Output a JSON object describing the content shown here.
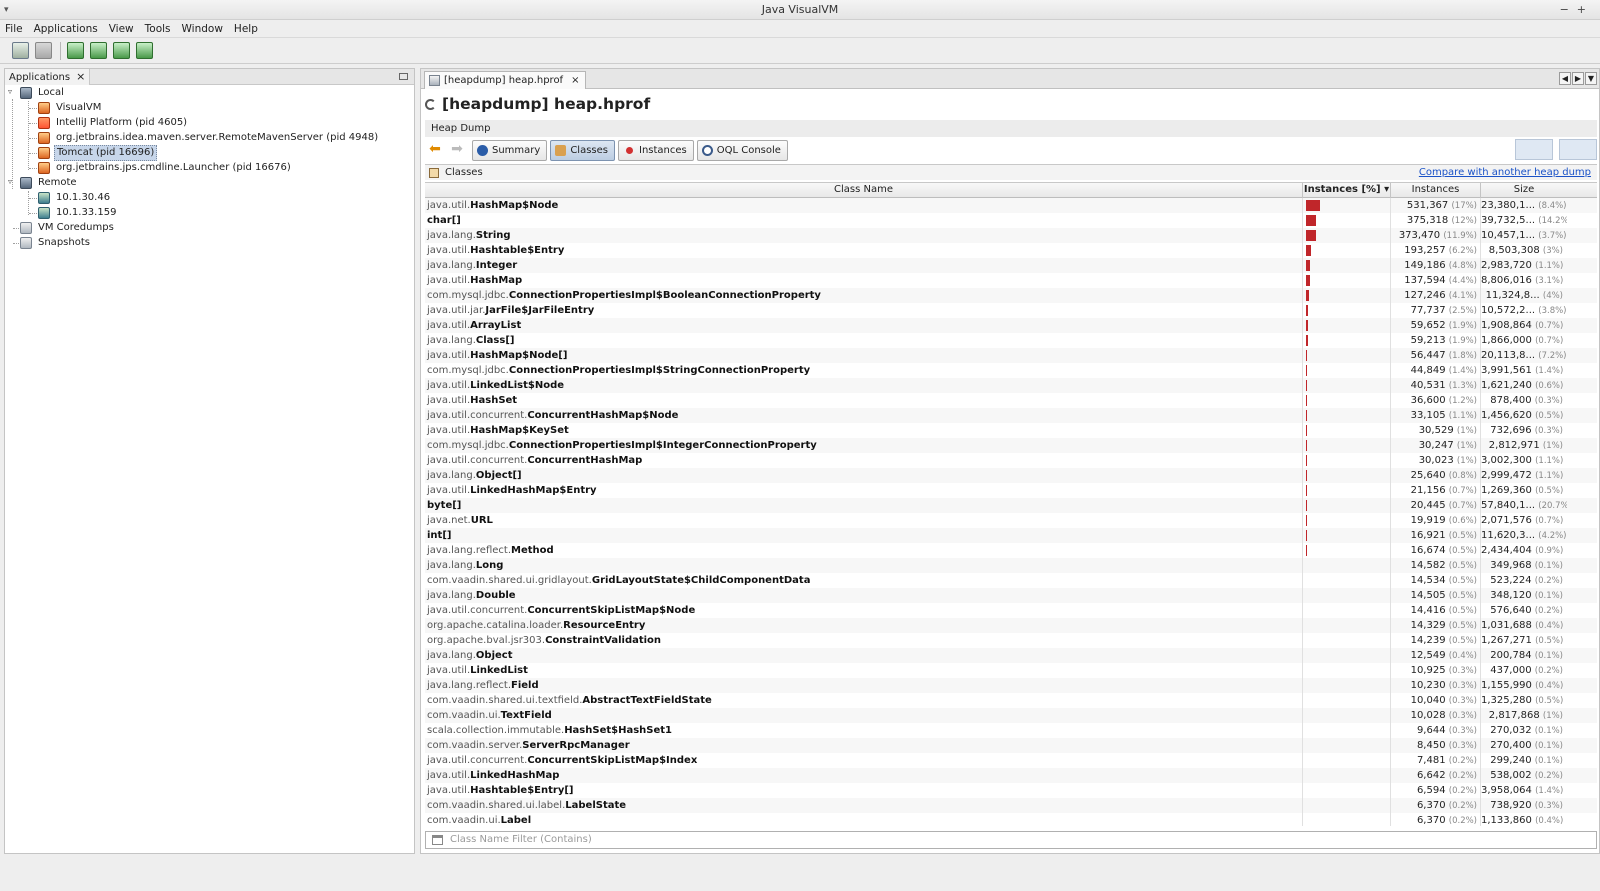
{
  "window": {
    "title": "Java VisualVM"
  },
  "menu": [
    "File",
    "Applications",
    "View",
    "Tools",
    "Window",
    "Help"
  ],
  "toolbar": {
    "icons": [
      "save-icon",
      "save-all-icon",
      "add-host-icon",
      "add-jmx-icon",
      "add-coredump-icon",
      "add-snapshot-icon"
    ]
  },
  "left_panel": {
    "tab_label": "Applications",
    "tree": {
      "local": "Local",
      "local_items": [
        "VisualVM",
        "IntelliJ Platform (pid 4605)",
        "org.jetbrains.idea.maven.server.RemoteMavenServer (pid 4948)",
        "Tomcat (pid 16696)",
        "org.jetbrains.jps.cmdline.Launcher (pid 16676)"
      ],
      "remote": "Remote",
      "remote_items": [
        "10.1.30.46",
        "10.1.33.159"
      ],
      "coredumps": "VM Coredumps",
      "snapshots": "Snapshots"
    }
  },
  "document": {
    "tab_label": "[heapdump] heap.hprof",
    "heading": "[heapdump] heap.hprof",
    "section_label": "Heap Dump",
    "views": [
      "Summary",
      "Classes",
      "Instances",
      "OQL Console"
    ],
    "active_view": "Classes",
    "classes_label": "Classes",
    "compare_link": "Compare with another heap dump",
    "columns": {
      "name": "Class Name",
      "pct": "Instances [%]",
      "instances": "Instances",
      "size": "Size"
    },
    "filter_placeholder": "Class Name Filter (Contains)"
  },
  "rows": [
    {
      "pkg": "java.util.",
      "cls": "HashMap$Node",
      "pct": 17,
      "inst": "531,367",
      "ip": "(17%)",
      "size": "23,380,1...",
      "sp": "(8.4%)"
    },
    {
      "pkg": "",
      "cls": "char[]",
      "pct": 12,
      "inst": "375,318",
      "ip": "(12%)",
      "size": "39,732,5...",
      "sp": "(14.2%)"
    },
    {
      "pkg": "java.lang.",
      "cls": "String",
      "pct": 11.9,
      "inst": "373,470",
      "ip": "(11.9%)",
      "size": "10,457,1...",
      "sp": "(3.7%)"
    },
    {
      "pkg": "java.util.",
      "cls": "Hashtable$Entry",
      "pct": 6.2,
      "inst": "193,257",
      "ip": "(6.2%)",
      "size": "8,503,308",
      "sp": "(3%)"
    },
    {
      "pkg": "java.lang.",
      "cls": "Integer",
      "pct": 4.8,
      "inst": "149,186",
      "ip": "(4.8%)",
      "size": "2,983,720",
      "sp": "(1.1%)"
    },
    {
      "pkg": "java.util.",
      "cls": "HashMap",
      "pct": 4.4,
      "inst": "137,594",
      "ip": "(4.4%)",
      "size": "8,806,016",
      "sp": "(3.1%)"
    },
    {
      "pkg": "com.mysql.jdbc.",
      "cls": "ConnectionPropertiesImpl$BooleanConnectionProperty",
      "pct": 4.1,
      "inst": "127,246",
      "ip": "(4.1%)",
      "size": "11,324,8...",
      "sp": "(4%)"
    },
    {
      "pkg": "java.util.jar.",
      "cls": "JarFile$JarFileEntry",
      "pct": 2.5,
      "inst": "77,737",
      "ip": "(2.5%)",
      "size": "10,572,2...",
      "sp": "(3.8%)"
    },
    {
      "pkg": "java.util.",
      "cls": "ArrayList",
      "pct": 1.9,
      "inst": "59,652",
      "ip": "(1.9%)",
      "size": "1,908,864",
      "sp": "(0.7%)"
    },
    {
      "pkg": "java.lang.",
      "cls": "Class[]",
      "pct": 1.9,
      "inst": "59,213",
      "ip": "(1.9%)",
      "size": "1,866,000",
      "sp": "(0.7%)"
    },
    {
      "pkg": "java.util.",
      "cls": "HashMap$Node[]",
      "pct": 1.8,
      "inst": "56,447",
      "ip": "(1.8%)",
      "size": "20,113,8...",
      "sp": "(7.2%)"
    },
    {
      "pkg": "com.mysql.jdbc.",
      "cls": "ConnectionPropertiesImpl$StringConnectionProperty",
      "pct": 1.4,
      "inst": "44,849",
      "ip": "(1.4%)",
      "size": "3,991,561",
      "sp": "(1.4%)"
    },
    {
      "pkg": "java.util.",
      "cls": "LinkedList$Node",
      "pct": 1.3,
      "inst": "40,531",
      "ip": "(1.3%)",
      "size": "1,621,240",
      "sp": "(0.6%)"
    },
    {
      "pkg": "java.util.",
      "cls": "HashSet",
      "pct": 1.2,
      "inst": "36,600",
      "ip": "(1.2%)",
      "size": "878,400",
      "sp": "(0.3%)"
    },
    {
      "pkg": "java.util.concurrent.",
      "cls": "ConcurrentHashMap$Node",
      "pct": 1.1,
      "inst": "33,105",
      "ip": "(1.1%)",
      "size": "1,456,620",
      "sp": "(0.5%)"
    },
    {
      "pkg": "java.util.",
      "cls": "HashMap$KeySet",
      "pct": 1,
      "inst": "30,529",
      "ip": "(1%)",
      "size": "732,696",
      "sp": "(0.3%)"
    },
    {
      "pkg": "com.mysql.jdbc.",
      "cls": "ConnectionPropertiesImpl$IntegerConnectionProperty",
      "pct": 1,
      "inst": "30,247",
      "ip": "(1%)",
      "size": "2,812,971",
      "sp": "(1%)"
    },
    {
      "pkg": "java.util.concurrent.",
      "cls": "ConcurrentHashMap",
      "pct": 1,
      "inst": "30,023",
      "ip": "(1%)",
      "size": "3,002,300",
      "sp": "(1.1%)"
    },
    {
      "pkg": "java.lang.",
      "cls": "Object[]",
      "pct": 0.8,
      "inst": "25,640",
      "ip": "(0.8%)",
      "size": "2,999,472",
      "sp": "(1.1%)"
    },
    {
      "pkg": "java.util.",
      "cls": "LinkedHashMap$Entry",
      "pct": 0.7,
      "inst": "21,156",
      "ip": "(0.7%)",
      "size": "1,269,360",
      "sp": "(0.5%)"
    },
    {
      "pkg": "",
      "cls": "byte[]",
      "pct": 0.7,
      "inst": "20,445",
      "ip": "(0.7%)",
      "size": "57,840,1...",
      "sp": "(20.7%)"
    },
    {
      "pkg": "java.net.",
      "cls": "URL",
      "pct": 0.6,
      "inst": "19,919",
      "ip": "(0.6%)",
      "size": "2,071,576",
      "sp": "(0.7%)"
    },
    {
      "pkg": "",
      "cls": "int[]",
      "pct": 0.5,
      "inst": "16,921",
      "ip": "(0.5%)",
      "size": "11,620,3...",
      "sp": "(4.2%)"
    },
    {
      "pkg": "java.lang.reflect.",
      "cls": "Method",
      "pct": 0.5,
      "inst": "16,674",
      "ip": "(0.5%)",
      "size": "2,434,404",
      "sp": "(0.9%)"
    },
    {
      "pkg": "java.lang.",
      "cls": "Long",
      "pct": 0.5,
      "inst": "14,582",
      "ip": "(0.5%)",
      "size": "349,968",
      "sp": "(0.1%)"
    },
    {
      "pkg": "com.vaadin.shared.ui.gridlayout.",
      "cls": "GridLayoutState$ChildComponentData",
      "pct": 0.5,
      "inst": "14,534",
      "ip": "(0.5%)",
      "size": "523,224",
      "sp": "(0.2%)"
    },
    {
      "pkg": "java.lang.",
      "cls": "Double",
      "pct": 0.5,
      "inst": "14,505",
      "ip": "(0.5%)",
      "size": "348,120",
      "sp": "(0.1%)"
    },
    {
      "pkg": "java.util.concurrent.",
      "cls": "ConcurrentSkipListMap$Node",
      "pct": 0.5,
      "inst": "14,416",
      "ip": "(0.5%)",
      "size": "576,640",
      "sp": "(0.2%)"
    },
    {
      "pkg": "org.apache.catalina.loader.",
      "cls": "ResourceEntry",
      "pct": 0.5,
      "inst": "14,329",
      "ip": "(0.5%)",
      "size": "1,031,688",
      "sp": "(0.4%)"
    },
    {
      "pkg": "org.apache.bval.jsr303.",
      "cls": "ConstraintValidation",
      "pct": 0.5,
      "inst": "14,239",
      "ip": "(0.5%)",
      "size": "1,267,271",
      "sp": "(0.5%)"
    },
    {
      "pkg": "java.lang.",
      "cls": "Object",
      "pct": 0.4,
      "inst": "12,549",
      "ip": "(0.4%)",
      "size": "200,784",
      "sp": "(0.1%)"
    },
    {
      "pkg": "java.util.",
      "cls": "LinkedList",
      "pct": 0.3,
      "inst": "10,925",
      "ip": "(0.3%)",
      "size": "437,000",
      "sp": "(0.2%)"
    },
    {
      "pkg": "java.lang.reflect.",
      "cls": "Field",
      "pct": 0.3,
      "inst": "10,230",
      "ip": "(0.3%)",
      "size": "1,155,990",
      "sp": "(0.4%)"
    },
    {
      "pkg": "com.vaadin.shared.ui.textfield.",
      "cls": "AbstractTextFieldState",
      "pct": 0.3,
      "inst": "10,040",
      "ip": "(0.3%)",
      "size": "1,325,280",
      "sp": "(0.5%)"
    },
    {
      "pkg": "com.vaadin.ui.",
      "cls": "TextField",
      "pct": 0.3,
      "inst": "10,028",
      "ip": "(0.3%)",
      "size": "2,817,868",
      "sp": "(1%)"
    },
    {
      "pkg": "scala.collection.immutable.",
      "cls": "HashSet$HashSet1",
      "pct": 0.3,
      "inst": "9,644",
      "ip": "(0.3%)",
      "size": "270,032",
      "sp": "(0.1%)"
    },
    {
      "pkg": "com.vaadin.server.",
      "cls": "ServerRpcManager",
      "pct": 0.3,
      "inst": "8,450",
      "ip": "(0.3%)",
      "size": "270,400",
      "sp": "(0.1%)"
    },
    {
      "pkg": "java.util.concurrent.",
      "cls": "ConcurrentSkipListMap$Index",
      "pct": 0.2,
      "inst": "7,481",
      "ip": "(0.2%)",
      "size": "299,240",
      "sp": "(0.1%)"
    },
    {
      "pkg": "java.util.",
      "cls": "LinkedHashMap",
      "pct": 0.2,
      "inst": "6,642",
      "ip": "(0.2%)",
      "size": "538,002",
      "sp": "(0.2%)"
    },
    {
      "pkg": "java.util.",
      "cls": "Hashtable$Entry[]",
      "pct": 0.2,
      "inst": "6,594",
      "ip": "(0.2%)",
      "size": "3,958,064",
      "sp": "(1.4%)"
    },
    {
      "pkg": "com.vaadin.shared.ui.label.",
      "cls": "LabelState",
      "pct": 0.2,
      "inst": "6,370",
      "ip": "(0.2%)",
      "size": "738,920",
      "sp": "(0.3%)"
    },
    {
      "pkg": "com.vaadin.ui.",
      "cls": "Label",
      "pct": 0.2,
      "inst": "6,370",
      "ip": "(0.2%)",
      "size": "1,133,860",
      "sp": "(0.4%)"
    }
  ]
}
